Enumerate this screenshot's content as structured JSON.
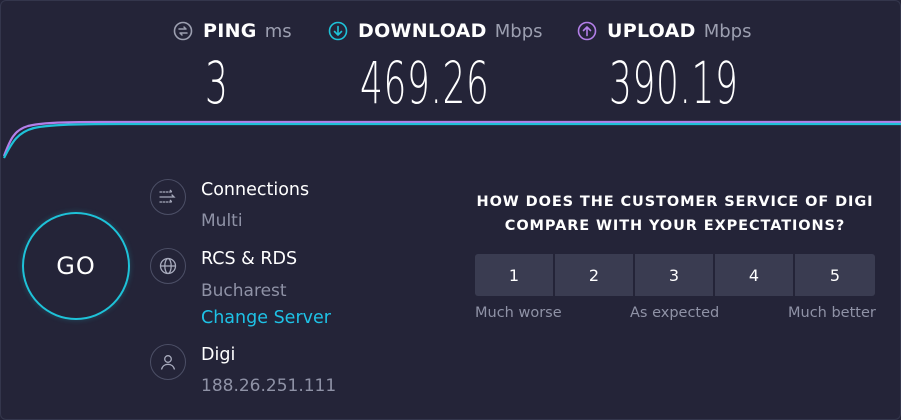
{
  "metrics": {
    "ping": {
      "label": "PING",
      "unit": "ms",
      "value": "3",
      "icon": "ping-icon"
    },
    "download": {
      "label": "DOWNLOAD",
      "unit": "Mbps",
      "value": "469.26",
      "icon": "download-arrow-icon",
      "color": "#1ec2d8"
    },
    "upload": {
      "label": "UPLOAD",
      "unit": "Mbps",
      "value": "390.19",
      "icon": "upload-arrow-icon",
      "color": "#b37fe8"
    }
  },
  "go_label": "GO",
  "connections": {
    "title": "Connections",
    "value": "Multi",
    "icon": "connections-icon"
  },
  "server": {
    "title": "RCS & RDS",
    "location": "Bucharest",
    "change_label": "Change Server",
    "icon": "globe-icon"
  },
  "provider": {
    "title": "Digi",
    "ip": "188.26.251.111",
    "icon": "user-icon"
  },
  "survey": {
    "question_line1": "HOW DOES THE CUSTOMER SERVICE OF DIGI",
    "question_line2": "COMPARE WITH YOUR EXPECTATIONS?",
    "options": [
      "1",
      "2",
      "3",
      "4",
      "5"
    ],
    "scale_low": "Much worse",
    "scale_mid": "As expected",
    "scale_high": "Much better"
  },
  "colors": {
    "background": "#232337",
    "accent_cyan": "#1ec2d8",
    "accent_purple": "#b37fe8",
    "muted_text": "#8f92a6"
  }
}
